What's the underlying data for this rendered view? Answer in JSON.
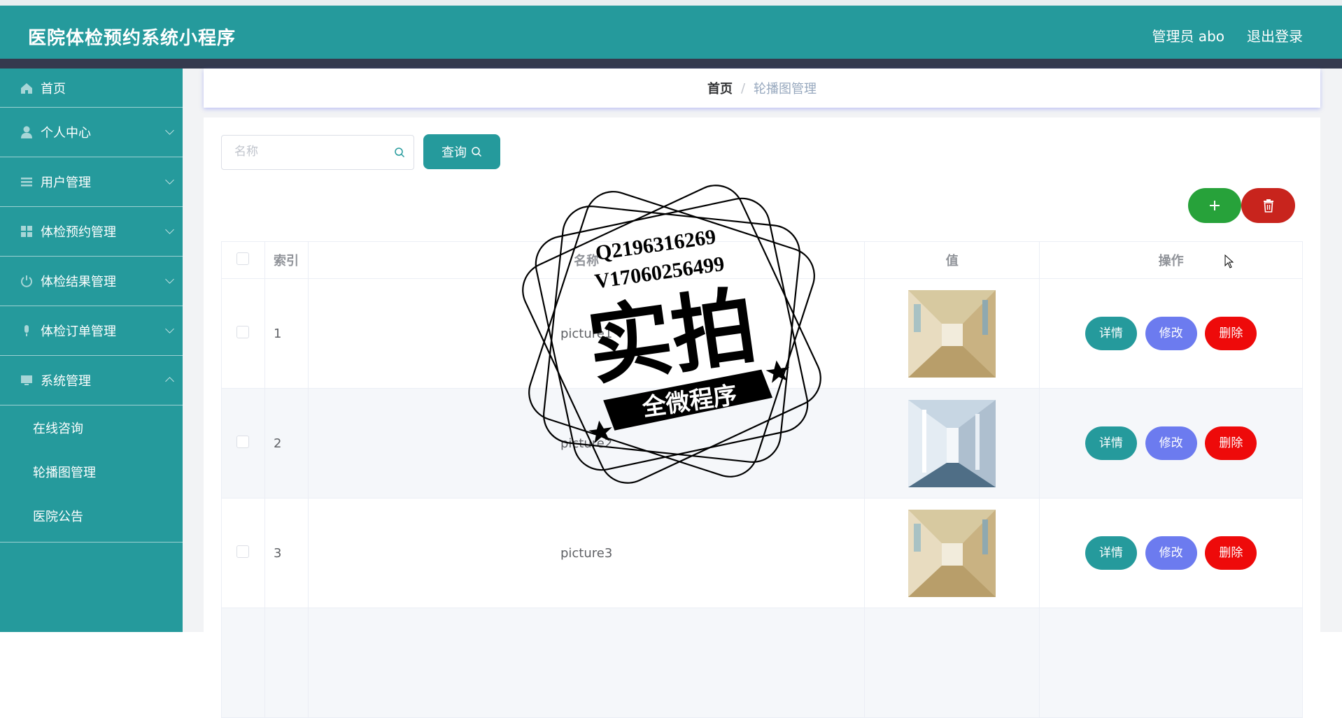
{
  "header": {
    "title": "医院体检预约系统小程序",
    "admin_label": "管理员 abo",
    "logout_label": "退出登录"
  },
  "sidebar": {
    "items": [
      {
        "label": "首页",
        "icon": "home-icon"
      },
      {
        "label": "个人中心",
        "icon": "user-icon"
      },
      {
        "label": "用户管理",
        "icon": "list-icon"
      },
      {
        "label": "体检预约管理",
        "icon": "grid-icon"
      },
      {
        "label": "体检结果管理",
        "icon": "power-icon"
      },
      {
        "label": "体检订单管理",
        "icon": "mic-icon"
      },
      {
        "label": "系统管理",
        "icon": "monitor-icon"
      }
    ],
    "submenu": [
      "在线咨询",
      "轮播图管理",
      "医院公告"
    ]
  },
  "breadcrumb": {
    "home": "首页",
    "separator": "/",
    "current": "轮播图管理"
  },
  "search": {
    "placeholder": "名称",
    "query_label": "查询"
  },
  "table": {
    "headers": {
      "index": "索引",
      "name": "名称",
      "value": "值",
      "actions": "操作"
    },
    "rows": [
      {
        "index": "1",
        "name": "picture1",
        "image": "hallway-photo"
      },
      {
        "index": "2",
        "name": "picture2",
        "image": "corridor-photo"
      },
      {
        "index": "3",
        "name": "picture3",
        "image": "hallway-photo"
      }
    ],
    "actions": {
      "detail": "详情",
      "edit": "修改",
      "delete": "删除"
    }
  },
  "watermark": {
    "line1": "Q2196316269",
    "line2": "V17060256499",
    "main": "实拍",
    "ribbon": "全微程序"
  },
  "colors": {
    "primary": "#259a9c",
    "add": "#27a23a",
    "delete_all": "#c8241d",
    "edit": "#6c7bef",
    "delete": "#ee0a0a"
  }
}
